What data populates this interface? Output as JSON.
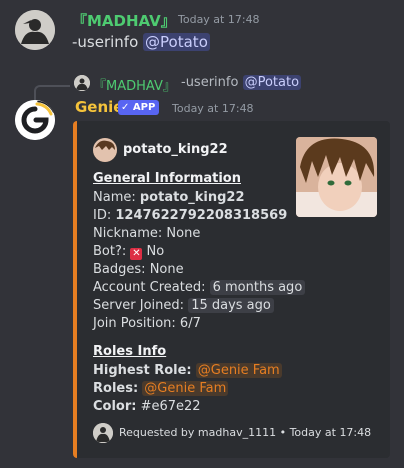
{
  "message1": {
    "author": "『MADHAV』",
    "timestamp": "Today at 17:48",
    "command": "-userinfo",
    "mention": "@Potato"
  },
  "reply": {
    "author": "『MADHAV』",
    "command": "-userinfo",
    "mention": "@Potato"
  },
  "message2": {
    "author": "Genie",
    "badge": "APP",
    "timestamp": "Today at 17:48"
  },
  "embed": {
    "accent_color": "#e67e22",
    "author_name": "potato_king22",
    "general_heading": "General Information",
    "name_label": "Name:",
    "name_value": "potato_king22",
    "id_label": "ID:",
    "id_value": "1247622792208318569",
    "nickname_label": "Nickname:",
    "nickname_value": "None",
    "bot_label": "Bot?:",
    "bot_value": "No",
    "badges_label": "Badges:",
    "badges_value": "None",
    "created_label": "Account Created:",
    "created_value": "6 months ago",
    "joined_label": "Server Joined:",
    "joined_value": "15 days ago",
    "position_label": "Join Position:",
    "position_value": "6/7",
    "roles_heading": "Roles Info",
    "highest_role_label": "Highest Role:",
    "highest_role_value": "@Genie Fam",
    "roles_label": "Roles:",
    "roles_value": "@Genie Fam",
    "color_label": "Color:",
    "color_value": "#e67e22",
    "footer_requested": "Requested by madhav_1111",
    "footer_separator": "•",
    "footer_time": "Today at 17:48"
  }
}
